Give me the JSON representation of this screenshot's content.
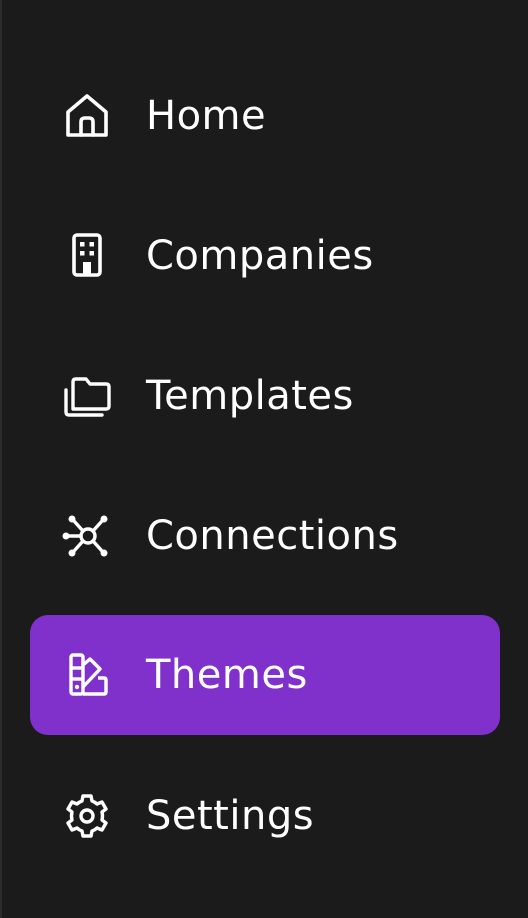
{
  "nav": {
    "items": [
      {
        "label": "Home",
        "icon": "home-icon",
        "active": false
      },
      {
        "label": "Companies",
        "icon": "building-icon",
        "active": false
      },
      {
        "label": "Templates",
        "icon": "folders-icon",
        "active": false
      },
      {
        "label": "Connections",
        "icon": "network-icon",
        "active": false
      },
      {
        "label": "Themes",
        "icon": "swatches-icon",
        "active": true
      },
      {
        "label": "Settings",
        "icon": "gear-icon",
        "active": false
      }
    ]
  },
  "colors": {
    "background": "#1b1b1b",
    "active_background": "#8031cc",
    "text": "#ffffff"
  }
}
